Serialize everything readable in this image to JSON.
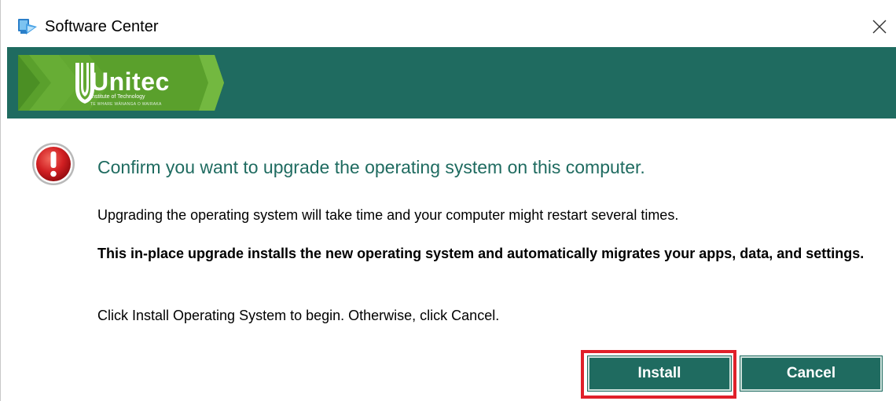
{
  "window": {
    "title": "Software Center",
    "icon": "software-center-icon",
    "close_icon": "close-icon"
  },
  "banner": {
    "logo_name": "Unitec",
    "logo_subtitle": "Institute of Technology",
    "logo_tagline": "TE WHARE WĀNANGA O WAIRAKA",
    "background_color": "#1f6b60",
    "logo_green": "#5aa02c"
  },
  "dialog": {
    "icon": "error-icon",
    "heading": "Confirm you want to upgrade the operating system on this computer.",
    "message1": "Upgrading the operating system will take time and your computer might restart several times.",
    "message2": "This in-place upgrade installs the new operating system and automatically migrates your apps, data, and settings.",
    "message3": "Click Install Operating System to begin. Otherwise, click Cancel.",
    "heading_color": "#1f6b60"
  },
  "buttons": {
    "install_label": "Install",
    "cancel_label": "Cancel",
    "button_color": "#1f6b60",
    "highlight_color": "#e0202a"
  }
}
